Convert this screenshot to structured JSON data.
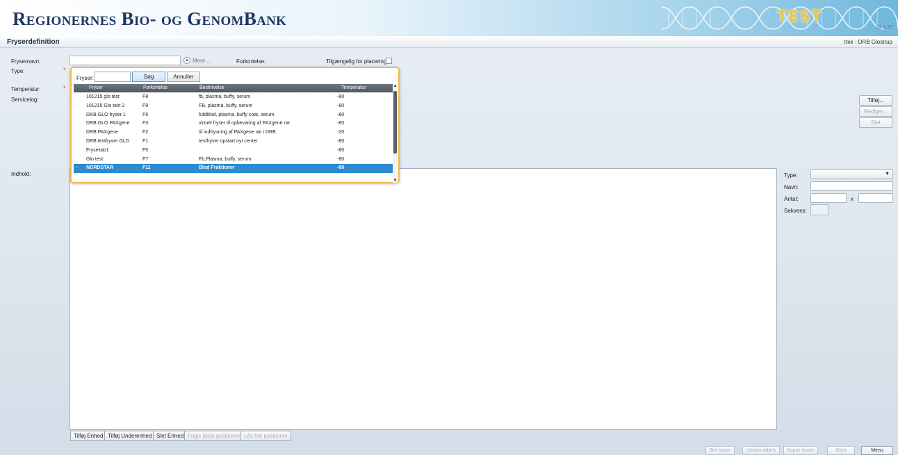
{
  "header": {
    "title": "Regionernes Bio- og GenomBank",
    "test_label": "TEST",
    "version": "12.1.37"
  },
  "page": {
    "title": "Fryserdefinition",
    "user": "tmk - DRB Glostrup"
  },
  "form": {
    "frysernavn_label": "Frysernavn:",
    "mere_label": "Mere ...",
    "forkortelse_label": "Forkortelse:",
    "tilgaengelig_label": "Tilgængelig for placering:",
    "type_label": "Type:",
    "temperatur_label": "Temperatur:",
    "servicelog_label": "Servicelog:",
    "indhold_label": "Indhold:"
  },
  "servicelog_buttons": {
    "tilfoj": "Tilføj...",
    "rediger": "Rediger...",
    "slet": "Slet"
  },
  "right_panel": {
    "type_label": "Type:",
    "navn_label": "Navn:",
    "antal_label": "Antal:",
    "x_label": "x",
    "sekvens_label": "Sekvens:"
  },
  "bottom_buttons": {
    "tilfoj_enhed": "Tilføj Enhed",
    "tilfoj_underenhed": "Tilføj Underenhed",
    "slet_enhed": "Slet Enhed",
    "frigiv": "Frigiv låste positioner",
    "las": "Lås frie positioner"
  },
  "footer_buttons": {
    "slet_fryser": "Slet fryser",
    "udskriv_labels": "Udskriv labels",
    "kopier_fryser": "Kopier fryser",
    "gem": "Gem",
    "menu": "Menu"
  },
  "popup": {
    "search_label": "Fryser:",
    "search_value": "",
    "sog_button": "Søg",
    "annuller_button": "Annuller",
    "columns": [
      "Fryser",
      "Forkortelse",
      "Beskrivelse",
      "Temperatur"
    ],
    "rows": [
      {
        "fryser": "101215 glo test",
        "forkortelse": "F8",
        "beskrivelse": "fb, plasma, buffy, serum",
        "temperatur": "-80"
      },
      {
        "fryser": "101215 Glo test 2",
        "forkortelse": "F9",
        "beskrivelse": "FB, plasma, buffy, serum",
        "temperatur": "-80"
      },
      {
        "fryser": "DRB GLO fryser 1",
        "forkortelse": "F6",
        "beskrivelse": "fuldblod, plasma, buffy coat, serum",
        "temperatur": "-80"
      },
      {
        "fryser": "DRB GLO PAXgene",
        "forkortelse": "F3",
        "beskrivelse": "virtuel fryser til opbevaring af PAXgene rør",
        "temperatur": "-80"
      },
      {
        "fryser": "DRB PAXgene",
        "forkortelse": "F2",
        "beskrivelse": "til indfrysning af PAXgene rør i DRB",
        "temperatur": "-20"
      },
      {
        "fryser": "DRB testfryser GLO",
        "forkortelse": "F1",
        "beskrivelse": "testfryser opstart nyt center",
        "temperatur": "-80"
      },
      {
        "fryser": "Frysekab1",
        "forkortelse": "F5",
        "beskrivelse": "",
        "temperatur": "-80"
      },
      {
        "fryser": "Glo test",
        "forkortelse": "F7",
        "beskrivelse": "Fb,Plasma, buffy, serum",
        "temperatur": "-80"
      },
      {
        "fryser": "NORDSTAR",
        "forkortelse": "F11",
        "beskrivelse": "Blod Fraktioner",
        "temperatur": "-80"
      }
    ]
  }
}
